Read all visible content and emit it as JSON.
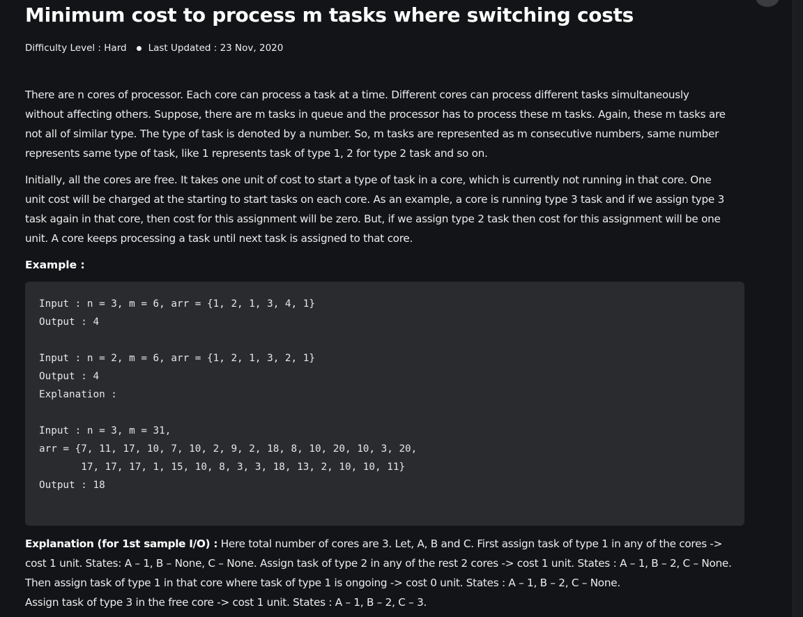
{
  "article": {
    "title": "Minimum cost to process m tasks where switching costs",
    "meta": {
      "difficulty": "Difficulty Level : Hard",
      "updated": "Last Updated : 23 Nov, 2020"
    },
    "intro_lines": [
      "There are n cores of processor. Each core can process a task at a time. Different cores can process different tasks simultaneously",
      "without affecting others. Suppose, there are m tasks in queue and the processor has to process these m tasks. Again, these m tasks are",
      "not all of similar type. The type of task is denoted by a number. So, m tasks are represented as m consecutive numbers, same number",
      "represents same type of task, like 1 represents task of type 1, 2 for type 2 task and so on."
    ],
    "cost_lines": [
      "Initially, all the cores are free. It takes one unit of cost to start a type of task in a core, which is currently not running in that core. One",
      "unit cost will be charged at the starting to start tasks on each core. As an example, a core is running type 3 task and if we assign type 3",
      "task again in that core, then cost for this assignment will be zero. But, if we assign type 2 task then cost for this assignment will be one",
      "unit. A core keeps processing a task until next task is assigned to that core."
    ],
    "example_heading": "Example :",
    "code_lines": [
      "Input : n = 3, m = 6, arr = {1, 2, 1, 3, 4, 1}",
      "Output : 4",
      "",
      "Input : n = 2, m = 6, arr = {1, 2, 1, 3, 2, 1}",
      "Output : 4",
      "Explanation :",
      "",
      "Input : n = 3, m = 31,",
      "arr = {7, 11, 17, 10, 7, 10, 2, 9, 2, 18, 8, 10, 20, 10, 3, 20,",
      "       17, 17, 17, 1, 15, 10, 8, 3, 3, 18, 13, 2, 10, 10, 11}",
      "Output : 18"
    ],
    "explanation": {
      "lead": "Explanation (for 1st sample I/O) :",
      "first_line_rest": " Here total number of cores are 3. Let, A, B and C. First assign task of type 1 in any of the cores ->",
      "more_lines": [
        "cost 1 unit. States: A – 1, B – None, C – None. Assign task of type 2 in any of the rest 2 cores -> cost 1 unit. States : A – 1, B – 2, C – None.",
        "Then assign task of type 1 in that core where task of type 1 is ongoing -> cost 0 unit. States : A – 1, B – 2, C – None.",
        "Assign task of type 3 in the free core -> cost 1 unit. States : A – 1, B – 2, C – 3."
      ]
    }
  },
  "colors": {
    "background": "#131417",
    "code_background": "#2a2b2f",
    "text": "#ececec",
    "heading": "#ffffff"
  }
}
